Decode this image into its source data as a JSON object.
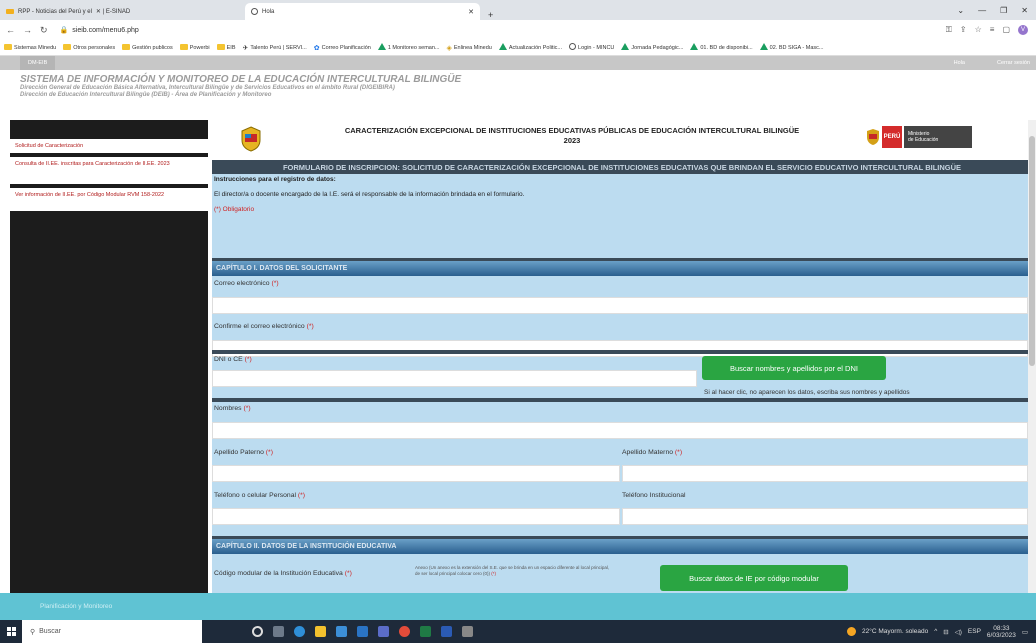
{
  "browser": {
    "tabs": [
      {
        "label": "RPP - Noticias del Perú y el",
        "extra": "✕  |  E-SINAD"
      },
      {
        "label": "Hola"
      }
    ],
    "url": "sieib.com/menu6.php",
    "bookmarks": [
      {
        "label": "Sistemas Minedu",
        "icon": "folder"
      },
      {
        "label": "Otros personales",
        "icon": "folder"
      },
      {
        "label": "Gestión publicos",
        "icon": "folder"
      },
      {
        "label": "Powerbi",
        "icon": "folder"
      },
      {
        "label": "EIB",
        "icon": "folder"
      },
      {
        "label": "Talento Perú | SERVI...",
        "icon": "page"
      },
      {
        "label": "Correo Planificación",
        "icon": "gear"
      },
      {
        "label": "1 Monitoreo seman...",
        "icon": "drive"
      },
      {
        "label": "Enlinea Minedu",
        "icon": "shield"
      },
      {
        "label": "Actualización Politic...",
        "icon": "drive"
      },
      {
        "label": "Login - MINCU",
        "icon": "globe"
      },
      {
        "label": "Jornada Pedagógic...",
        "icon": "drive"
      },
      {
        "label": "01. BD de disponibi...",
        "icon": "drive"
      },
      {
        "label": "02. BD SIGA - Masc...",
        "icon": "drive"
      }
    ]
  },
  "site": {
    "brand": "DM-EIB",
    "hello": "Hola",
    "logout": "Cerrar sesión",
    "title": "SISTEMA DE INFORMACIÓN Y MONITOREO DE LA EDUCACIÓN INTERCULTURAL BILINGÜE",
    "sub1": "Dirección General de Educación Básica Alternativa, Intercultural Bilingüe y de Servicios Educativos en el ámbito Rural (DIGEIBIRA)",
    "sub2": "Dirección de Educación Intercultural Bilingüe (DEIB) - Área de Planificación y Monitoreo"
  },
  "sidebar": {
    "items": [
      {
        "label": "Solicitud de Caracterización"
      },
      {
        "label": "Consulta de II.EE. inscritas para Caracterización de II.EE. 2023"
      },
      {
        "label": "Ver información de II.EE. por Código Modular RVM 158-2022"
      }
    ]
  },
  "banner": {
    "title": "CARACTERIZACIÓN EXCEPCIONAL DE INSTITUCIONES EDUCATIVAS PÚBLICAS DE EDUCACIÓN INTERCULTURAL BILINGÜE",
    "year": "2023",
    "peru": "PERÚ",
    "ministerio": "Ministerio",
    "de_educacion": "de Educación"
  },
  "form": {
    "title": "FORMULARIO DE INSCRIPCION: SOLICITUD DE CARACTERIZACIÓN EXCEPCIONAL DE INSTITUCIONES EDUCATIVAS QUE BRINDAN EL SERVICIO EDUCATIVO INTERCULTURAL BILINGÜE",
    "instr_heading": "Instrucciones para el registro de datos:",
    "instr_text": "El director/a o docente encargado de la I.E. será el responsable de la información brindada en el formulario.",
    "obligatorio": "(*) Obligatorio",
    "cap1": "CAPÍTULO I.  DATOS DEL SOLICITANTE",
    "correo": "Correo electrónico",
    "confirme": "Confirme el correo electrónico",
    "dni": "DNI o CE",
    "btn_dni": "Buscar nombres y apellidos por el DNI",
    "dni_note": "Si al hacer clic, no aparecen los datos, escriba sus nombres y apellidos",
    "nombres": "Nombres",
    "ap_paterno": "Apellido Paterno",
    "ap_materno": "Apellido Materno",
    "telefono": "Teléfono o celular Personal",
    "tel_inst": "Teléfono Institucional",
    "cap2": "CAPÍTULO II.  DATOS DE LA INSTITUCIÓN EDUCATIVA",
    "codigo": "Código modular de la Institución Educativa",
    "anexo_note": "Anexo (Un anexo es la extensión del S.E. que se brinda en un espacio diferente al local principal, de ser local principal colocar cero (0))",
    "btn_ie": "Buscar datos de IE por código modular",
    "req_mark": "(*)"
  },
  "footer": {
    "text": "Planificación y Monitoreo"
  },
  "taskbar": {
    "search": "Buscar",
    "weather": "22°C  Mayorm. soleado",
    "lang": "ESP",
    "time": "08:33",
    "date": "6/03/2023"
  }
}
